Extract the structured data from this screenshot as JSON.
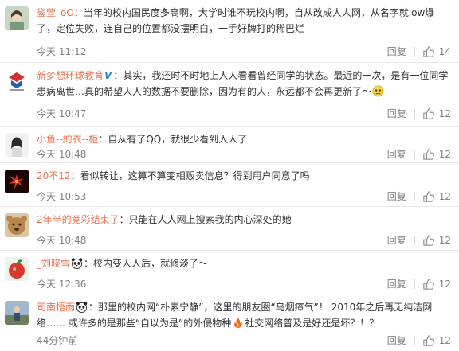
{
  "comments": [
    {
      "user": "鋆萱_oO",
      "text": "当年的校内国民度多高啊，大学时谁不玩校内啊，自从改成人人网，从名字就low爆了，定位失败，连自己的位置都没摆明白，一手好牌打的稀巴烂",
      "time": "今天 11:12",
      "reply": "回复",
      "likes": "14"
    },
    {
      "user": "新梦想环球教育",
      "text": "其实，我还时不时地上人人看看曾经同学的状态。最近的一次，是有一位同学患病离世…真的希望人人的数据不要删除，因为有的人，永远都不会再更新了～",
      "time": "今天 10:47",
      "reply": "回复",
      "likes": "12"
    },
    {
      "user": "小鱼--的衣--柜",
      "text": "自从有了QQ，就很少看到人人了",
      "time": "今天 10:48",
      "reply": "回复",
      "likes": "12"
    },
    {
      "user": "20不12",
      "text": "看似转让，这算不算变相贩卖信息？得到用户同意了吗",
      "time": "今天 10:53",
      "reply": "回复",
      "likes": "12"
    },
    {
      "user": "2年半的竞彩结束了",
      "text": "只能在人人网上搜索我的内心深处的她",
      "time": "今天 10:48",
      "reply": "回复",
      "likes": "12"
    },
    {
      "user": "_刘晓雪",
      "text": "校内变人人后，就修淡了～",
      "time": "今天 12:36",
      "reply": "回复",
      "likes": "12"
    },
    {
      "user": "司南悟雨",
      "text_part1": "那里的校内网“朴素宁静”，这里的朋友圈“乌烟瘴气”！ 2010年之后再无纯洁网络…… 或许多的是那些“自以为是”的外侵物种",
      "text_part2": "社交网络普及是好还是坏？！？",
      "time": "44分钟前",
      "reply": "回复",
      "likes": "12"
    }
  ],
  "colors": {
    "username": "#eb7350",
    "meta": "#808080",
    "text": "#333333",
    "divider": "#e8e8e8"
  },
  "icons": [
    "thumbs-up-icon",
    "verified-v-icon",
    "sad-emoji-icon",
    "panda-emoji-icon",
    "fire-emoji-icon"
  ]
}
